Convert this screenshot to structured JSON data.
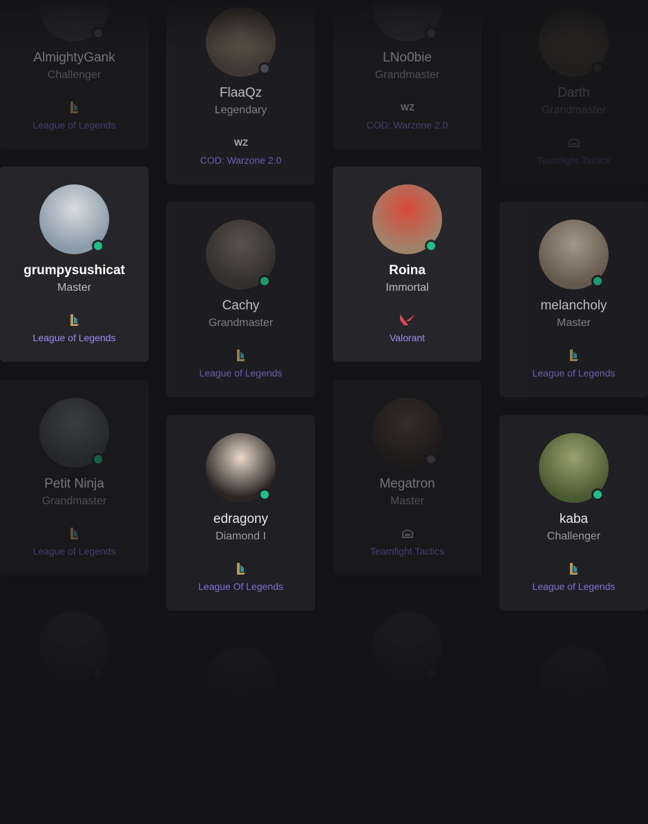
{
  "players": [
    {
      "name": "AlmightyGank",
      "rank": "Challenger",
      "game": "League of Legends",
      "game_icon": "league-of-legends-icon",
      "status": "offline"
    },
    {
      "name": "FlaaQz",
      "rank": "Legendary",
      "game": "COD: Warzone 2.0",
      "game_icon": "warzone-icon",
      "status": "offline"
    },
    {
      "name": "LNo0bie",
      "rank": "Grandmaster",
      "game": "COD: Warzone 2.0",
      "game_icon": "warzone-icon",
      "status": "offline"
    },
    {
      "name": "Darth",
      "rank": "Grandmaster",
      "game": "Teamfight Tactics",
      "game_icon": "teamfight-tactics-icon",
      "status": "offline"
    },
    {
      "name": "grumpysushicat",
      "rank": "Master",
      "game": "League of Legends",
      "game_icon": "league-of-legends-icon",
      "status": "online"
    },
    {
      "name": "Cachy",
      "rank": "Grandmaster",
      "game": "League of Legends",
      "game_icon": "league-of-legends-icon",
      "status": "online"
    },
    {
      "name": "Roina",
      "rank": "Immortal",
      "game": "Valorant",
      "game_icon": "valorant-icon",
      "status": "online"
    },
    {
      "name": "melancholy",
      "rank": "Master",
      "game": "League of Legends",
      "game_icon": "league-of-legends-icon",
      "status": "online"
    },
    {
      "name": "Petit Ninja",
      "rank": "Grandmaster",
      "game": "League of Legends",
      "game_icon": "league-of-legends-icon",
      "status": "online"
    },
    {
      "name": "edragony",
      "rank": "Diamond I",
      "game": "League Of Legends",
      "game_icon": "league-of-legends-icon",
      "status": "online"
    },
    {
      "name": "Megatron",
      "rank": "Master",
      "game": "Teamfight Tactics",
      "game_icon": "teamfight-tactics-icon",
      "status": "offline"
    },
    {
      "name": "kaba",
      "rank": "Challenger",
      "game": "League of Legends",
      "game_icon": "league-of-legends-icon",
      "status": "online"
    },
    {
      "name": "",
      "rank": "",
      "game": "",
      "game_icon": "",
      "status": "offline"
    },
    {
      "name": "",
      "rank": "",
      "game": "",
      "game_icon": "",
      "status": "offline"
    },
    {
      "name": "",
      "rank": "",
      "game": "",
      "game_icon": "",
      "status": "offline"
    },
    {
      "name": "",
      "rank": "",
      "game": "",
      "game_icon": "",
      "status": "offline"
    }
  ],
  "colors": {
    "background": "#141416",
    "card": "#202024",
    "card_highlight": "#26262a",
    "online": "#1fbf85",
    "offline": "#55555c",
    "game_link": "#9a8ef2",
    "valorant": "#e8454f"
  }
}
